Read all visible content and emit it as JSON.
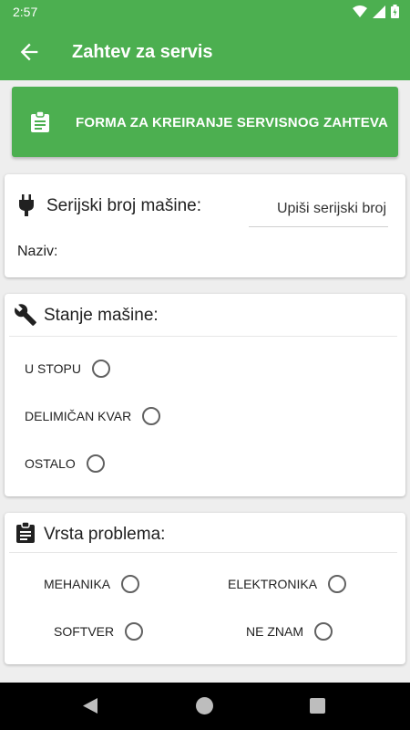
{
  "status_bar": {
    "time": "2:57"
  },
  "app_bar": {
    "title": "Zahtev za servis"
  },
  "banner": {
    "text": "FORMA ZA KREIRANJE SERVISNOG ZAHTEVA"
  },
  "machine_card": {
    "serial_label": "Serijski broj mašine:",
    "serial_placeholder": "Upiši serijski broj",
    "serial_value": "",
    "name_label": "Naziv:"
  },
  "condition_card": {
    "title": "Stanje mašine:",
    "options": [
      "U STOPU",
      "DELIMIČAN KVAR",
      "OSTALO"
    ]
  },
  "problem_card": {
    "title": "Vrsta problema:",
    "options": [
      "MEHANIKA",
      "ELEKTRONIKA",
      "SOFTVER",
      "NE ZNAM"
    ]
  },
  "colors": {
    "primary": "#4caf50",
    "background": "#eeeeee",
    "radio_border": "#616161"
  },
  "icons": [
    "wifi-icon",
    "signal-icon",
    "battery-icon",
    "back-arrow-icon",
    "clipboard-icon",
    "plug-icon",
    "wrench-icon"
  ]
}
